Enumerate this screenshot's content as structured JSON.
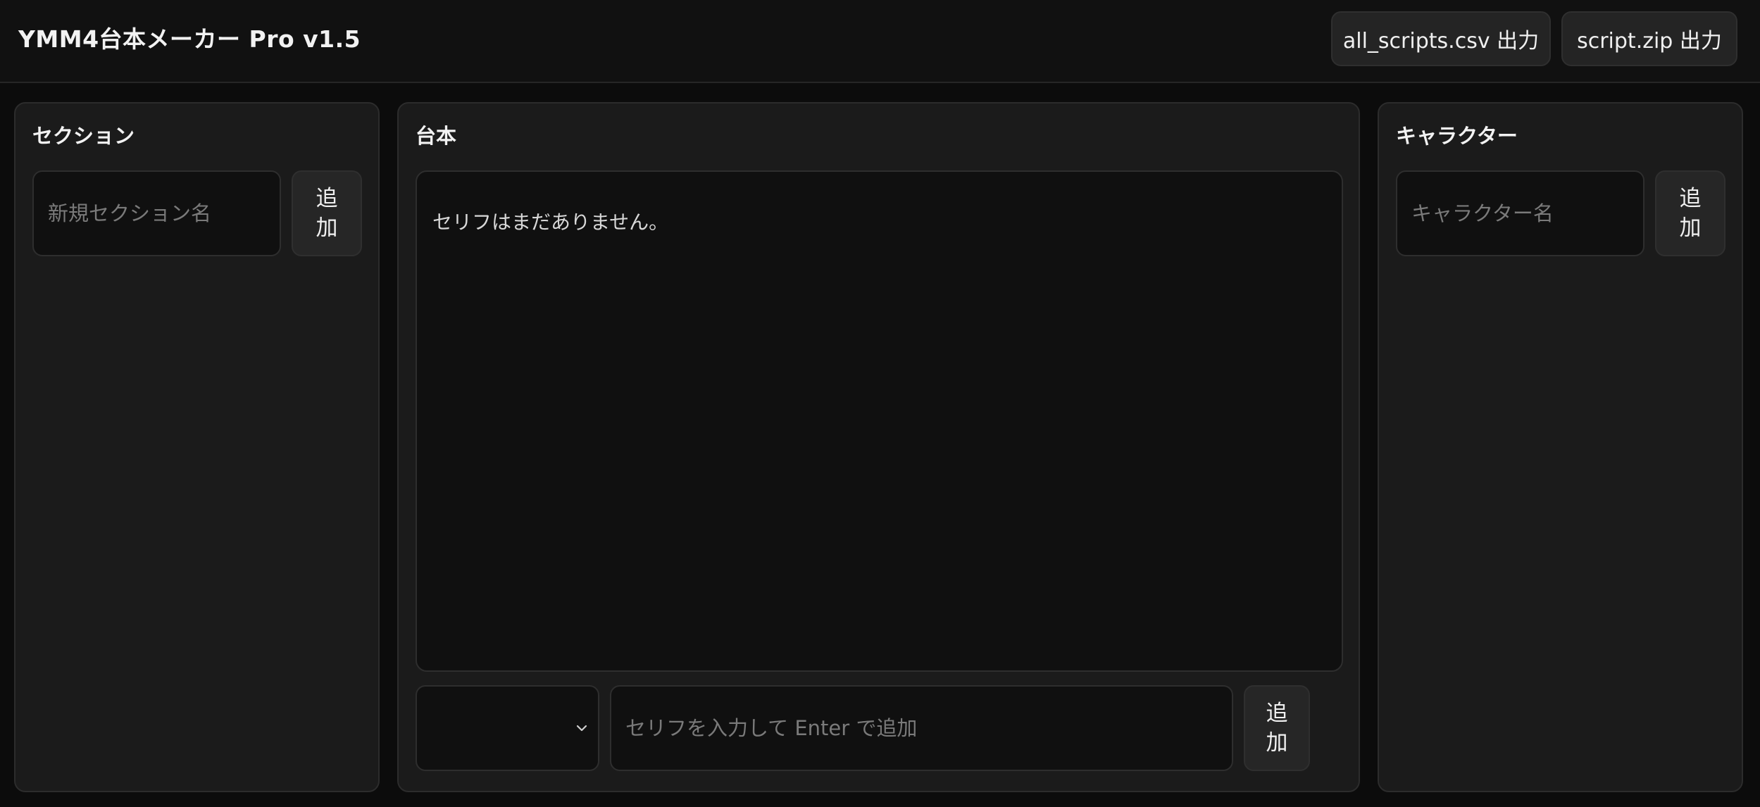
{
  "header": {
    "title": "YMM4台本メーカー Pro v1.5",
    "export_csv_label": "all_scripts.csv 出力",
    "export_zip_label": "script.zip 出力"
  },
  "sections_panel": {
    "title": "セクション",
    "input_placeholder": "新規セクション名",
    "add_label": "追加"
  },
  "script_panel": {
    "title": "台本",
    "empty_message": "セリフはまだありません。",
    "character_select_value": "",
    "line_input_placeholder": "セリフを入力して Enter で追加",
    "add_label": "追加"
  },
  "characters_panel": {
    "title": "キャラクター",
    "input_placeholder": "キャラクター名",
    "add_label": "追加"
  },
  "icons": {
    "select_chevron": "chevron-down-icon"
  }
}
